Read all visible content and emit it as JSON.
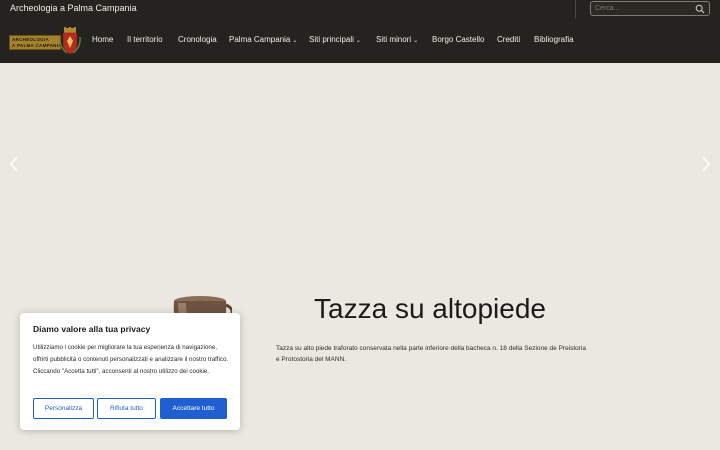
{
  "topbar": {
    "site_title": "Archeologia a Palma Campania",
    "search_placeholder": "Cerca..."
  },
  "logo": {
    "line1": "ARCHEOLOGIA",
    "line2": "A PALMA CAMPANIA"
  },
  "nav": {
    "items": [
      {
        "label": "Home",
        "dropdown": false
      },
      {
        "label": "Il territorio",
        "dropdown": false
      },
      {
        "label": "Cronologia",
        "dropdown": false
      },
      {
        "label": "Palma Campania",
        "dropdown": true
      },
      {
        "label": "Siti principali",
        "dropdown": true
      },
      {
        "label": "Siti minori",
        "dropdown": true
      },
      {
        "label": "Borgo Castello",
        "dropdown": false
      },
      {
        "label": "Crediti",
        "dropdown": false
      },
      {
        "label": "Bibliografia",
        "dropdown": false
      }
    ]
  },
  "hero": {
    "title": "Tazza su altopiede",
    "caption": "Tazza su alto piede traforato conservata nella parte inferiore della bacheca n. 18 della Sezione de Preistoria e Protostoria del MANN."
  },
  "cookie": {
    "title": "Diamo valore alla tua privacy",
    "text": "Utilizziamo i cookie per migliorare la tua esperienza di navigazione, offrirti pubblicità o contenuti personalizzati e analizzare il nostro traffico. Cliccando \"Accetta tutti\", acconsenti al nostro utilizzo dei cookie.",
    "btn_customize": "Personalizza",
    "btn_reject": "Rifiuta tutto",
    "btn_accept": "Accettare tutto"
  },
  "colors": {
    "header_bg": "#24231f",
    "hero_bg": "#ebe7e1",
    "accent_blue": "#1f5fd1"
  },
  "icons": {
    "search": "search-icon",
    "chevron_down": "chevron-down-icon",
    "arrow_left": "chevron-left-icon",
    "arrow_right": "chevron-right-icon"
  }
}
